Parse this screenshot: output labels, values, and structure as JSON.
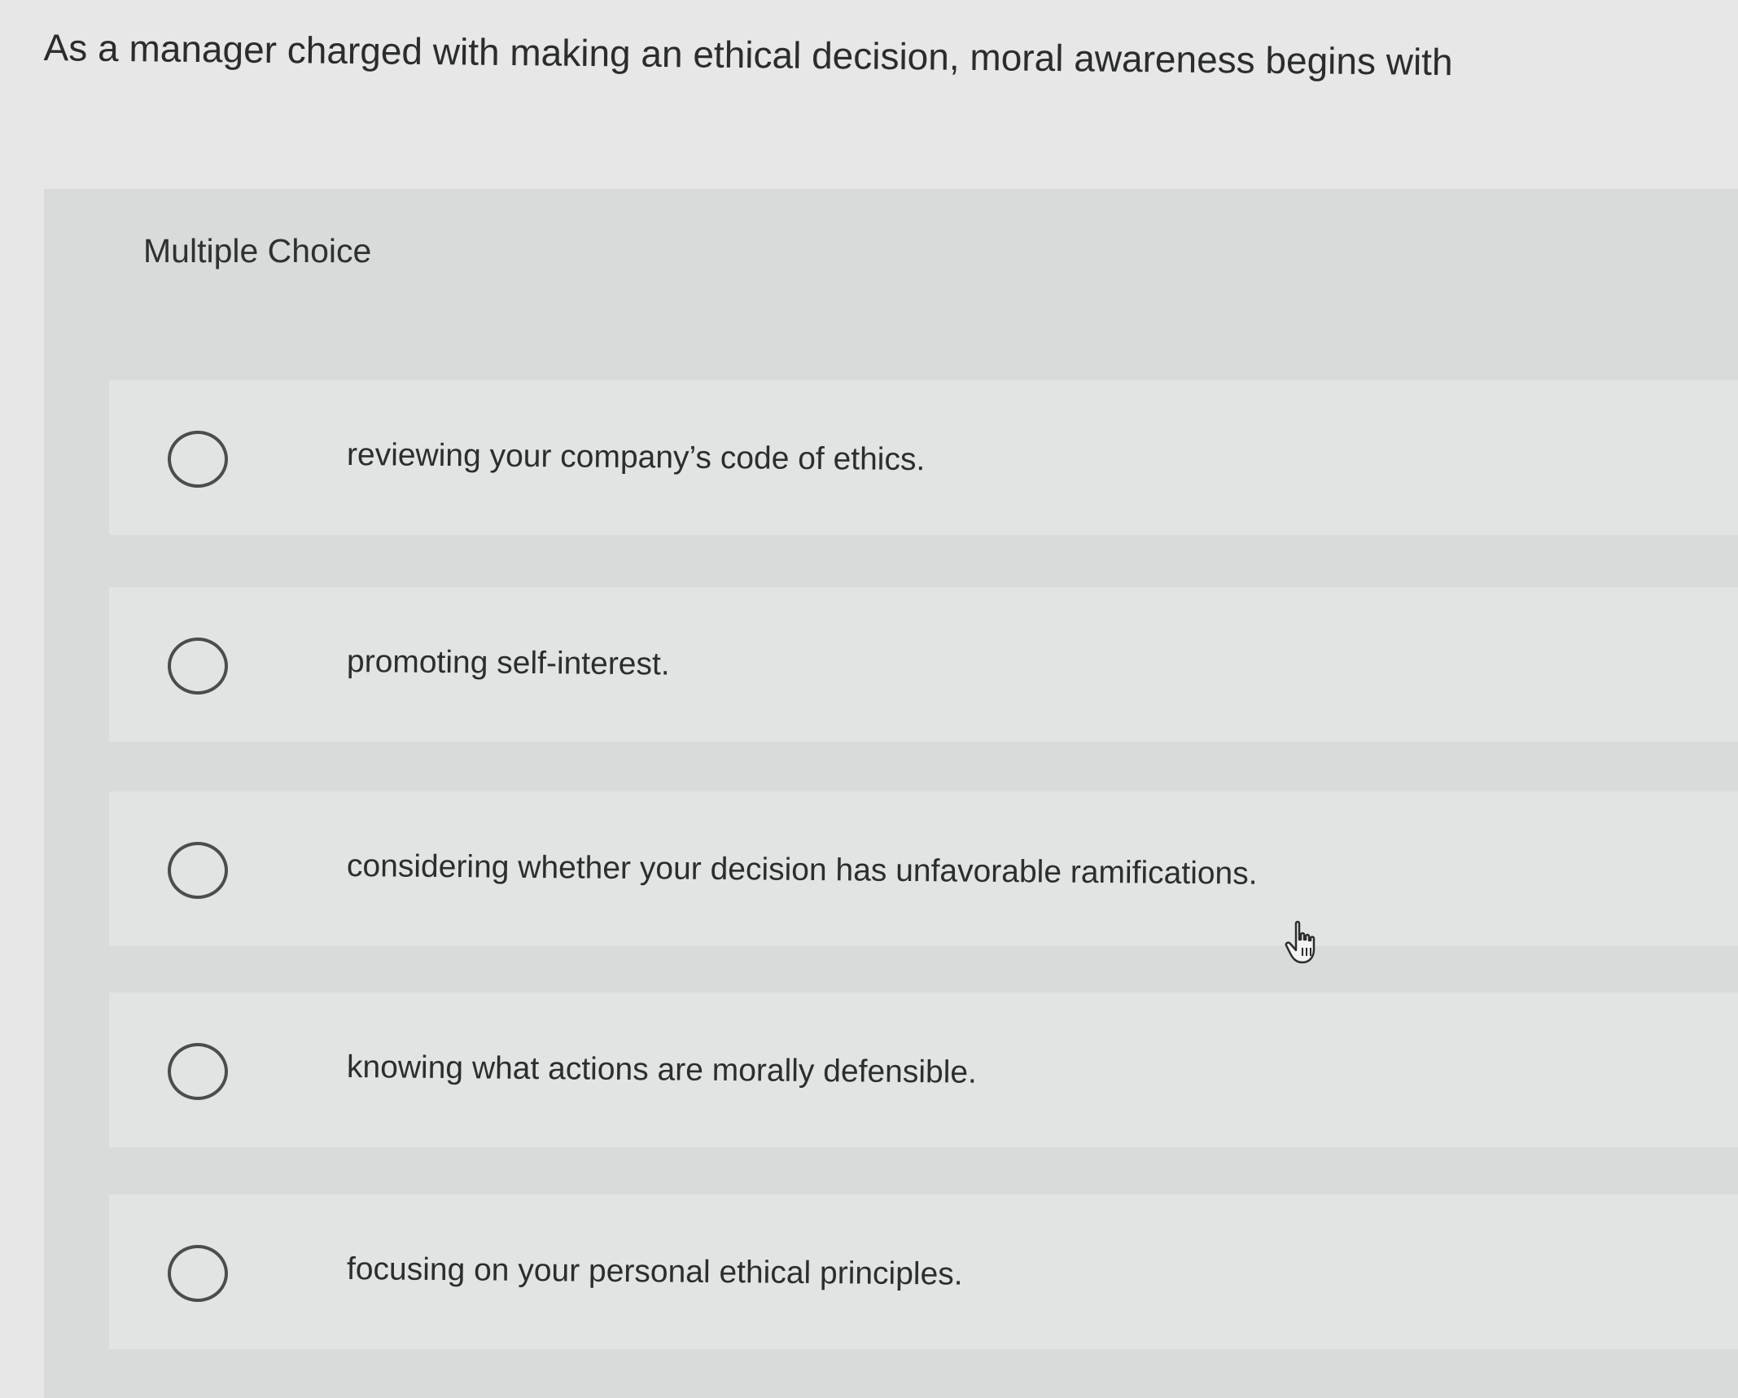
{
  "question": {
    "text": "As a manager charged with making an ethical decision, moral awareness begins with"
  },
  "panel": {
    "title": "Multiple Choice",
    "options": [
      {
        "label": "reviewing your company’s code of ethics.",
        "selected": false
      },
      {
        "label": "promoting self-interest.",
        "selected": false
      },
      {
        "label": "considering whether your decision has unfavorable ramifications.",
        "selected": false
      },
      {
        "label": "knowing what actions are morally defensible.",
        "selected": false
      },
      {
        "label": "focusing on your personal ethical principles.",
        "selected": false
      }
    ]
  },
  "cursor": {
    "icon": "hand-pointer-icon"
  },
  "colors": {
    "page_background": "#e6e7e6",
    "panel_background": "#d9dbdb",
    "option_background": "#e2e3e3",
    "text": "#2b2d2e",
    "radio_border": "#4a4c4e"
  }
}
